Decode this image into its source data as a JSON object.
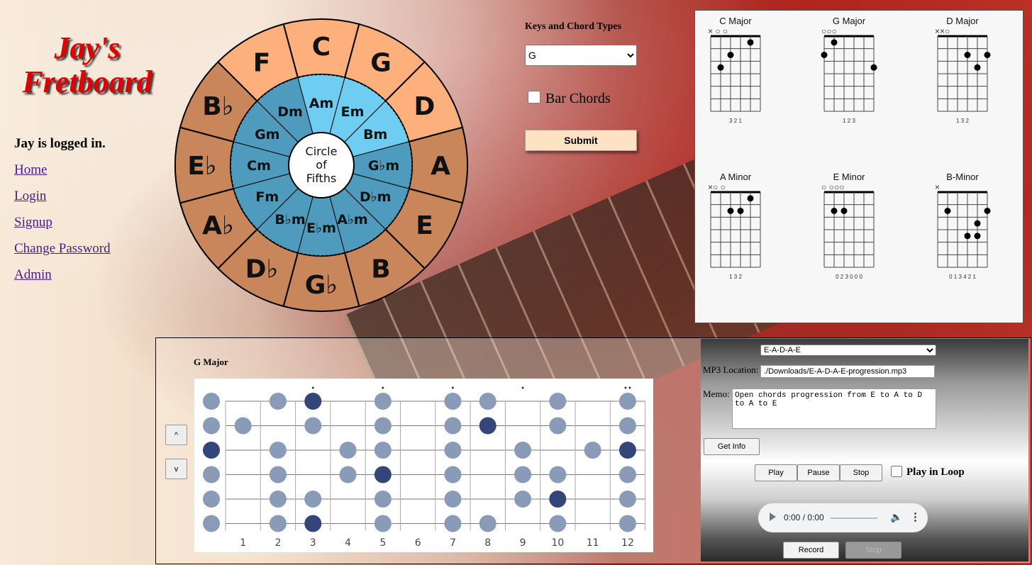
{
  "logo": {
    "line1": "Jay's",
    "line2": "Fretboard"
  },
  "user_status": "Jay is logged in.",
  "nav": [
    "Home",
    "Login",
    "Signup",
    "Change Password",
    "Admin"
  ],
  "circle_of_fifths": {
    "center_lines": [
      "Circle",
      "of",
      "Fifths"
    ],
    "major": [
      "C",
      "G",
      "D",
      "A",
      "E",
      "B",
      "G♭",
      "D♭",
      "A♭",
      "E♭",
      "B♭",
      "F"
    ],
    "minor": [
      "Am",
      "Em",
      "Bm",
      "G♭m",
      "D♭m",
      "A♭m",
      "E♭m",
      "B♭m",
      "Fm",
      "Cm",
      "Gm",
      "Dm"
    ],
    "highlight_major": [
      "F",
      "C",
      "G",
      "D"
    ],
    "highlight_minor": [
      "Am",
      "Em",
      "Bm"
    ],
    "colors": {
      "major_light": "#fdb07c",
      "major": "#c8865a",
      "minor_light": "#6fcdf2",
      "minor": "#4e9bbd"
    }
  },
  "keys_form": {
    "label": "Keys and Chord Types",
    "selected_key": "G",
    "bar_chords_label": "Bar Chords",
    "submit_label": "Submit"
  },
  "chords": [
    {
      "name": "C Major",
      "top": "×  ○ ○",
      "fingers": "3 2   1"
    },
    {
      "name": "G Major",
      "top": "○○○",
      "fingers": "1 2       3"
    },
    {
      "name": "D Major",
      "top": "××○",
      "fingers": "1  3  2"
    },
    {
      "name": "A Minor",
      "top": "×○       ○",
      "fingers": "1  3  2"
    },
    {
      "name": "E Minor",
      "top": "○    ○○○",
      "fingers": "0  2  3  0  0  0"
    },
    {
      "name": "B-Minor",
      "top": "×",
      "fingers": "0  1  3  4  2  1"
    }
  ],
  "fretboard": {
    "title": "G Major",
    "up_label": "^",
    "down_label": "v",
    "fret_numbers": [
      "1",
      "2",
      "3",
      "4",
      "5",
      "6",
      "7",
      "8",
      "9",
      "10",
      "11",
      "12"
    ],
    "root_color": "#34457a",
    "note_color": "#8a9bb8"
  },
  "player": {
    "progression": "E-A-D-A-E",
    "mp3_label": "MP3 Location:",
    "mp3_value": "./Downloads/E-A-D-A-E-progression.mp3",
    "memo_label": "Memo:",
    "memo_value": "Open chords progression from E to A to D to A to E",
    "get_info": "Get Info",
    "play": "Play",
    "pause": "Pause",
    "stop": "Stop",
    "loop_label": "Play in Loop",
    "audio_time": "0:00 / 0:00",
    "record": "Record",
    "stop_record": "Stop"
  }
}
